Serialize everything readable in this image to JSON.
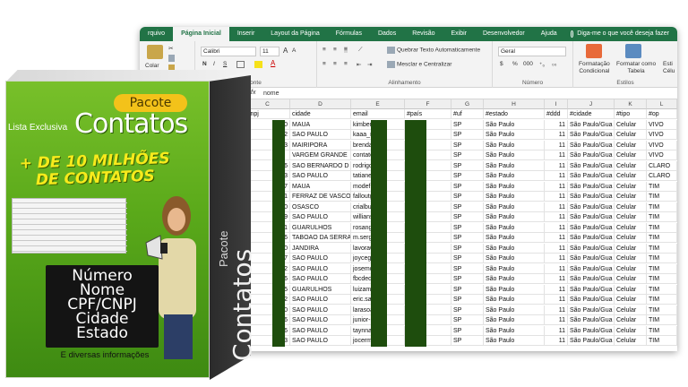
{
  "excel": {
    "tabs": [
      {
        "label": "rquivo",
        "active": false
      },
      {
        "label": "Página Inicial",
        "active": true
      },
      {
        "label": "Inserir",
        "active": false
      },
      {
        "label": "Layout da Página",
        "active": false
      },
      {
        "label": "Fórmulas",
        "active": false
      },
      {
        "label": "Dados",
        "active": false
      },
      {
        "label": "Revisão",
        "active": false
      },
      {
        "label": "Exibir",
        "active": false
      },
      {
        "label": "Desenvolvedor",
        "active": false
      },
      {
        "label": "Ajuda",
        "active": false
      }
    ],
    "tell_me": "Diga-me o que você deseja fazer",
    "ribbon": {
      "paste": "Colar",
      "font_name": "Calibri",
      "font_size": "11",
      "bold": "N",
      "italic": "I",
      "underline": "S",
      "grow": "A",
      "shrink": "A",
      "font_group": "onte",
      "wrap_text": "Quebrar Texto Automaticamente",
      "merge_center": "Mesclar e Centralizar",
      "alignment_group": "Alinhamento",
      "number_format": "Geral",
      "percent": "%",
      "thousands": "000",
      "number_group": "Número",
      "cond_format_1": "Formatação",
      "cond_format_2": "Condicional",
      "format_table_1": "Formatar como",
      "format_table_2": "Tabela",
      "cell_styles_1": "Esti",
      "cell_styles_2": "Célu",
      "styles_group": "Estilos"
    },
    "formula_bar": {
      "fx": "fx",
      "content": "nome"
    },
    "columns": [
      "C",
      "D",
      "E",
      "F",
      "G",
      "H",
      "I",
      "J",
      "K",
      "L"
    ],
    "header_row": [
      "cnpj",
      "cidade",
      "email",
      "#país",
      "#uf",
      "#estado",
      "#ddd",
      "#cidade",
      "#tipo",
      "#op"
    ],
    "rows": [
      {
        "c": "420",
        "d": "MAUA",
        "e": "kimberl",
        "f": "Brasil",
        "g": "SP",
        "h": "São Paulo",
        "i": "11",
        "j": "São Paulo/Gua",
        "k": "Celular",
        "l": "VIVO"
      },
      {
        "c": "392",
        "d": "SAO PAULO",
        "e": "kaaa_rin",
        "f": "Brasil",
        "g": "SP",
        "h": "São Paulo",
        "i": "11",
        "j": "São Paulo/Gua",
        "k": "Celular",
        "l": "VIVO"
      },
      {
        "c": "463",
        "d": "MAIRIPORA",
        "e": "brenda.",
        "f": "Brasil",
        "g": "SP",
        "h": "São Paulo",
        "i": "11",
        "j": "São Paulo/Gua",
        "k": "Celular",
        "l": "VIVO"
      },
      {
        "c": "",
        "d": "VARGEM GRANDE",
        "e": "contato",
        "f": "Brasil",
        "g": "SP",
        "h": "São Paulo",
        "i": "11",
        "j": "São Paulo/Gua",
        "k": "Celular",
        "l": "VIVO"
      },
      {
        "c": "376",
        "d": "SAO BERNARDO D",
        "e": "rodrigo",
        "f": "Brasil",
        "g": "SP",
        "h": "São Paulo",
        "i": "11",
        "j": "São Paulo/Gua",
        "k": "Celular",
        "l": "CLARO"
      },
      {
        "c": "223",
        "d": "SAO PAULO",
        "e": "tatiane.",
        "f": "Brasil",
        "g": "SP",
        "h": "São Paulo",
        "i": "11",
        "j": "São Paulo/Gua",
        "k": "Celular",
        "l": "CLARO"
      },
      {
        "c": "107",
        "d": "MAUA",
        "e": "modefre",
        "f": "Brasil",
        "g": "SP",
        "h": "São Paulo",
        "i": "11",
        "j": "São Paulo/Gua",
        "k": "Celular",
        "l": "TIM"
      },
      {
        "c": "341",
        "d": "FERRAZ DE VASCO",
        "e": "falloutg",
        "f": "Brasil",
        "g": "SP",
        "h": "São Paulo",
        "i": "11",
        "j": "São Paulo/Gua",
        "k": "Celular",
        "l": "TIM"
      },
      {
        "c": "410",
        "d": "OSASCO",
        "e": "crialbun",
        "f": "Brasil",
        "g": "SP",
        "h": "São Paulo",
        "i": "11",
        "j": "São Paulo/Gua",
        "k": "Celular",
        "l": "TIM"
      },
      {
        "c": "639",
        "d": "SAO PAULO",
        "e": "willians",
        "f": "Brasil",
        "g": "SP",
        "h": "São Paulo",
        "i": "11",
        "j": "São Paulo/Gua",
        "k": "Celular",
        "l": "TIM"
      },
      {
        "c": "101",
        "d": "GUARULHOS",
        "e": "rosange",
        "f": "Brasil",
        "g": "SP",
        "h": "São Paulo",
        "i": "11",
        "j": "São Paulo/Gua",
        "k": "Celular",
        "l": "TIM"
      },
      {
        "c": "436",
        "d": "TABOAO DA SERRA",
        "e": "m.sergi",
        "f": "Brasil",
        "g": "SP",
        "h": "São Paulo",
        "i": "11",
        "j": "São Paulo/Gua",
        "k": "Celular",
        "l": "TIM"
      },
      {
        "c": "530",
        "d": "JANDIRA",
        "e": "lavora08",
        "f": "Brasil",
        "g": "SP",
        "h": "São Paulo",
        "i": "11",
        "j": "São Paulo/Gua",
        "k": "Celular",
        "l": "TIM"
      },
      {
        "c": "457",
        "d": "SAO PAULO",
        "e": "joycegal",
        "f": "Brasil",
        "g": "SP",
        "h": "São Paulo",
        "i": "11",
        "j": "São Paulo/Gua",
        "k": "Celular",
        "l": "TIM"
      },
      {
        "c": "32",
        "d": "SAO PAULO",
        "e": "josemor",
        "f": "Brasil",
        "g": "SP",
        "h": "São Paulo",
        "i": "11",
        "j": "São Paulo/Gua",
        "k": "Celular",
        "l": "TIM"
      },
      {
        "c": "226",
        "d": "SAO PAULO",
        "e": "fbcdede",
        "f": "Brasil",
        "g": "SP",
        "h": "São Paulo",
        "i": "11",
        "j": "São Paulo/Gua",
        "k": "Celular",
        "l": "TIM"
      },
      {
        "c": "455",
        "d": "GUARULHOS",
        "e": "luizamr",
        "f": "Brasil",
        "g": "SP",
        "h": "São Paulo",
        "i": "11",
        "j": "São Paulo/Gua",
        "k": "Celular",
        "l": "TIM"
      },
      {
        "c": "352",
        "d": "SAO PAULO",
        "e": "eric.saa",
        "f": "Brasil",
        "g": "SP",
        "h": "São Paulo",
        "i": "11",
        "j": "São Paulo/Gua",
        "k": "Celular",
        "l": "TIM"
      },
      {
        "c": "360",
        "d": "SAO PAULO",
        "e": "larasoar",
        "f": "Brasil",
        "g": "SP",
        "h": "São Paulo",
        "i": "11",
        "j": "São Paulo/Gua",
        "k": "Celular",
        "l": "TIM"
      },
      {
        "c": "226",
        "d": "SAO PAULO",
        "e": "junior-n",
        "f": "Brasil",
        "g": "SP",
        "h": "São Paulo",
        "i": "11",
        "j": "São Paulo/Gua",
        "k": "Celular",
        "l": "TIM"
      },
      {
        "c": "466",
        "d": "SAO PAULO",
        "e": "taynnah",
        "f": "Brasil",
        "g": "SP",
        "h": "São Paulo",
        "i": "11",
        "j": "São Paulo/Gua",
        "k": "Celular",
        "l": "TIM"
      },
      {
        "c": "383",
        "d": "SAO PAULO",
        "e": "jocerm",
        "f": "Brasil",
        "g": "SP",
        "h": "São Paulo",
        "i": "11",
        "j": "São Paulo/Gua",
        "k": "Celular",
        "l": "TIM"
      }
    ]
  },
  "product": {
    "badge": "Pacote",
    "lista": "Lista Exclusiva",
    "title": "Contatos",
    "headline_1": "+ DE 10 MILHÕES",
    "headline_2": "DE CONTATOS",
    "items": [
      "Número",
      "Nome",
      "CPF/CNPJ",
      "Cidade",
      "Estado"
    ],
    "extra": "E diversas informações",
    "side_small": "Pacote",
    "side_big": "Contatos",
    "colors": {
      "green": "#5aa91a",
      "yellow": "#f3c21a",
      "excel": "#217346"
    }
  }
}
